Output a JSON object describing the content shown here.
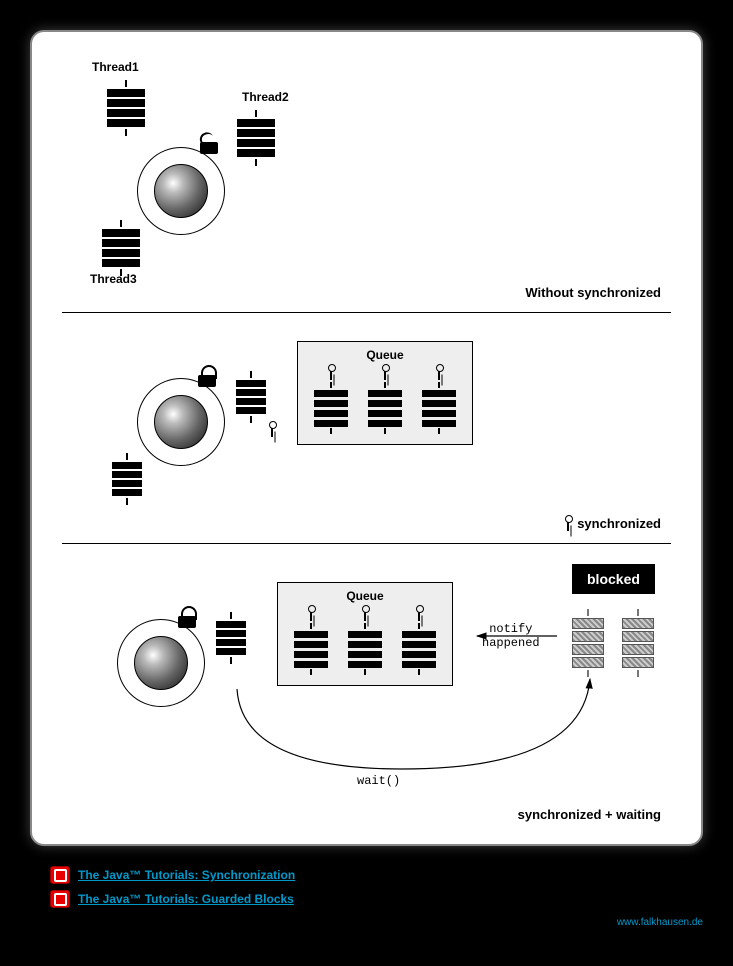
{
  "section1": {
    "thread1": "Thread1",
    "thread2": "Thread2",
    "thread3": "Thread3",
    "caption": "Without synchronized"
  },
  "section2": {
    "queueTitle": "Queue",
    "caption": "synchronized",
    "keyPrefix": ""
  },
  "section3": {
    "queueTitle": "Queue",
    "blocked": "blocked",
    "notify": "notify\nhappened",
    "wait": "wait()",
    "caption": "synchronized + waiting"
  },
  "links": {
    "l1": "The Java™ Tutorials: Synchronization",
    "l2": "The Java™ Tutorials: Guarded Blocks"
  },
  "footer": "www.falkhausen.de"
}
